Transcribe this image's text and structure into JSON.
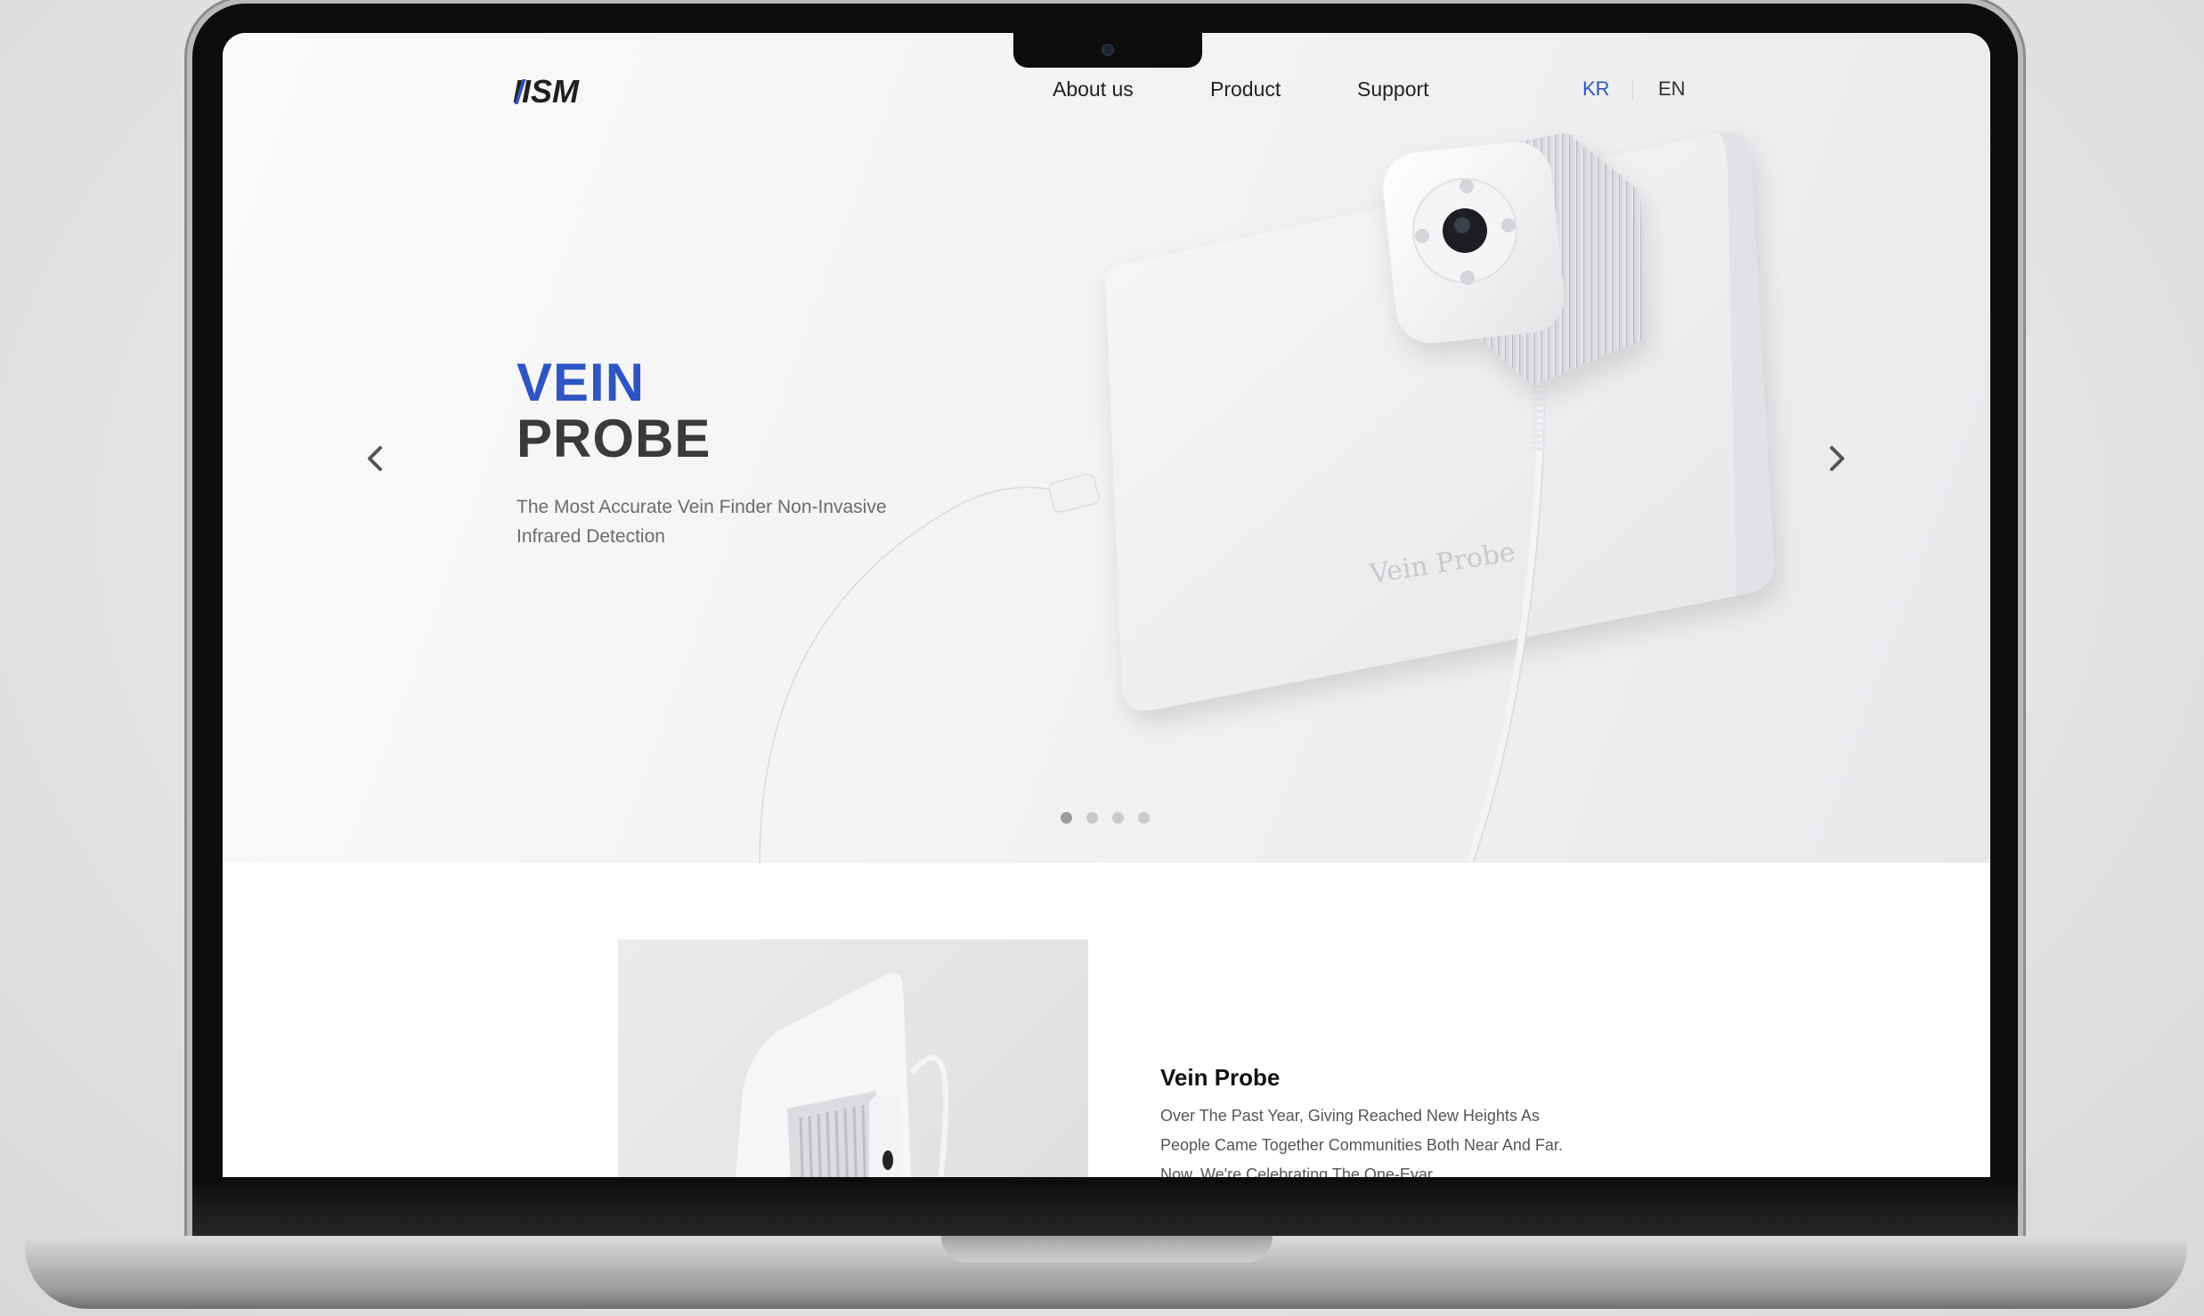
{
  "brand": {
    "logo_text": "IISM"
  },
  "nav": {
    "items": [
      "About us",
      "Product",
      "Support"
    ],
    "lang_kr": "KR",
    "lang_en": "EN"
  },
  "hero": {
    "title_line1": "VEIN",
    "title_line2": "PROBE",
    "subtitle": "The Most Accurate Vein Finder Non-Invasive Infrared Detection",
    "device_label": "Vein Probe",
    "slide_count": 4,
    "active_slide": 1,
    "accent_color": "#2f55c4"
  },
  "product": {
    "title": "Vein Probe",
    "description": "Over The Past Year, Giving Reached New Heights As People Came Together Communities Both Near And Far. Now, We're Celebrating The One-Eyar"
  },
  "icons": [
    "chevron-left-icon",
    "chevron-right-icon",
    "webcam-icon"
  ]
}
